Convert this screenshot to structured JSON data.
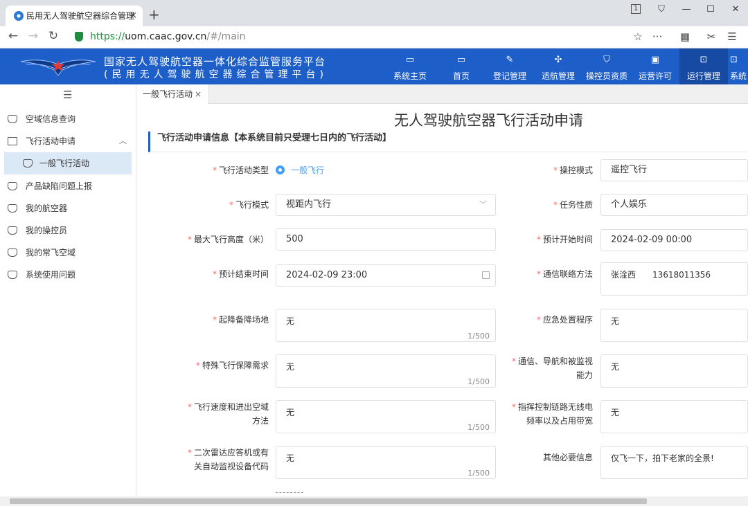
{
  "browser": {
    "tab_title": "民用无人驾驶航空器综合管理",
    "tab_close": "×",
    "new_tab": "+",
    "tab_count": "1",
    "url_scheme": "https://",
    "url_host": "uom.caac.gov.cn",
    "url_path": "/#/main"
  },
  "header": {
    "title_line1": "国家无人驾驶航空器一体化综合监管服务平台",
    "title_line2": "(民用无人驾驶航空器综合管理平台)",
    "nav": [
      {
        "label": "系统主页",
        "icon": "monitor-settings-icon"
      },
      {
        "label": "首页",
        "icon": "desktop-icon"
      },
      {
        "label": "登记管理",
        "icon": "register-doc-icon"
      },
      {
        "label": "适航管理",
        "icon": "drone-icon"
      },
      {
        "label": "操控员资质",
        "icon": "shield-icon"
      },
      {
        "label": "运营许可",
        "icon": "id-card-icon"
      },
      {
        "label": "运行管理",
        "icon": "operation-icon"
      },
      {
        "label": "系统",
        "icon": "system-icon"
      }
    ],
    "colors": {
      "bar": "#1e5ec8",
      "active": "#174aa3"
    }
  },
  "sidebar": {
    "items": [
      {
        "label": "空域信息查询"
      },
      {
        "label": "飞行活动申请",
        "expanded": true
      },
      {
        "label": "产品缺陷问题上报"
      },
      {
        "label": "我的航空器"
      },
      {
        "label": "我的操控员"
      },
      {
        "label": "我的常飞空域"
      },
      {
        "label": "系统使用问题"
      }
    ],
    "sub_item": "一般飞行活动"
  },
  "page_tab": {
    "label": "一般飞行活动",
    "close": "×"
  },
  "form": {
    "title": "无人驾驶航空器飞行活动申请",
    "section": "飞行活动申请信息【本系统目前只受理七日内的飞行活动】",
    "required_mark": "*",
    "counter": "1/500",
    "fields": {
      "activity_type": {
        "label": "飞行活动类型",
        "value": "一般飞行"
      },
      "control_mode": {
        "label": "操控模式",
        "value": "遥控飞行"
      },
      "flight_mode": {
        "label": "飞行模式",
        "value": "视距内飞行"
      },
      "task_nature": {
        "label": "任务性质",
        "value": "个人娱乐"
      },
      "max_altitude": {
        "label": "最大飞行高度（米）",
        "value": "500"
      },
      "start_time": {
        "label": "预计开始时间",
        "value": "2024-02-09 00:00"
      },
      "end_time": {
        "label": "预计结束时间",
        "value": "2024-02-09 23:00"
      },
      "contact": {
        "label": "通信联络方法",
        "value": "张淦西　　13618011356"
      },
      "takeoff_site": {
        "label": "起降备降场地",
        "value": "无"
      },
      "emergency": {
        "label": "应急处置程序",
        "value": "无"
      },
      "special_needs": {
        "label": "特殊飞行保障需求",
        "value": "无"
      },
      "comm_nav_l1": "通信、导航和被监视",
      "comm_nav_l2": "能力",
      "comm_nav_value": "无",
      "speed_l1": "飞行速度和进出空域",
      "speed_l2": "方法",
      "speed_value": "无",
      "link_l1": "指挥控制链路无线电",
      "link_l2": "频率以及占用带宽",
      "link_value": "无",
      "radar_l1": "二次雷达应答机或有",
      "radar_l2": "关自动监视设备代码",
      "radar_value": "无",
      "other": {
        "label": "其他必要信息",
        "value": "仅飞一下，拍下老家的全景!"
      }
    }
  }
}
